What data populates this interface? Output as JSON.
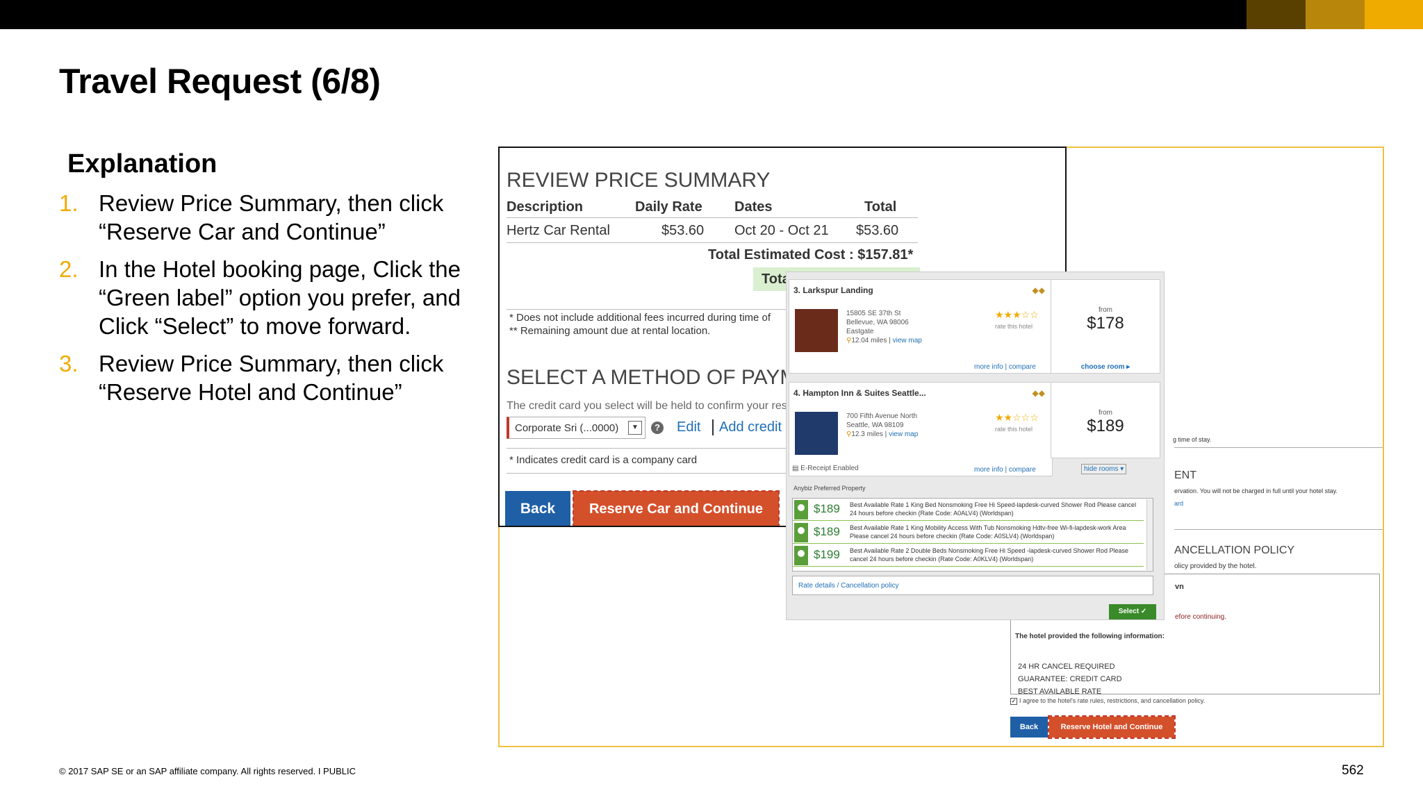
{
  "header": {
    "swatch_colors": [
      "#5a4000",
      "#b8860b",
      "#f0ab00"
    ]
  },
  "slide": {
    "title": "Travel Request (6/8)",
    "explanation_heading": "Explanation",
    "steps": [
      {
        "num": "1.",
        "text": "Review Price Summary, then click “Reserve Car and Continue”"
      },
      {
        "num": "2.",
        "text": "In the Hotel booking page, Click the “Green label” option you prefer, and Click “Select” to move forward."
      },
      {
        "num": "3.",
        "text": "Review Price Summary, then click “Reserve Hotel and Continue”"
      }
    ],
    "footer": "© 2017 SAP SE or an SAP affiliate company. All rights reserved.   I   PUBLIC",
    "page_number": "562"
  },
  "car_summary": {
    "heading": "REVIEW PRICE SUMMARY",
    "columns": [
      "Description",
      "Daily Rate",
      "Dates",
      "Total"
    ],
    "row": [
      "Hertz Car Rental",
      "$53.60",
      "Oct 20 - Oct 21",
      "$53.60"
    ],
    "total_estimated": "Total Estimated Cost : $157.81*",
    "total_green": "Tota",
    "note1": "* Does not include additional fees incurred during time of",
    "note2": "** Remaining amount due at rental location.",
    "payment_heading": "SELECT A METHOD OF PAYME",
    "payment_text": "The credit card you select will be held to confirm your res",
    "card_value": "Corporate Sri (...0000)",
    "edit": "Edit",
    "add_card": "Add credit ca",
    "company_note": "* Indicates credit card is a company card",
    "back": "Back",
    "reserve": "Reserve Car and Continue"
  },
  "hotels": [
    {
      "name": "3. Larkspur Landing",
      "diamonds": "◆◆",
      "address": [
        "15805 SE 37th St",
        "Bellevue, WA 98006",
        "Eastgate"
      ],
      "distance": "12.04 miles",
      "view_map": "view map",
      "stars": "★★★☆☆",
      "rate_text": "rate this hotel",
      "more_info": "more info",
      "compare": "compare",
      "from": "from",
      "price": "$178",
      "cta": "choose room ▸"
    },
    {
      "name": "4. Hampton Inn & Suites Seattle...",
      "diamonds": "◆◆",
      "address": [
        "700 Fifth Avenue North",
        "Seattle, WA 98109"
      ],
      "distance": "12.3 miles",
      "view_map": "view map",
      "stars": "★★☆☆☆",
      "rate_text": "rate this hotel",
      "more_info": "more info",
      "compare": "compare",
      "from": "from",
      "price": "$189",
      "cta": "hide rooms ▾"
    }
  ],
  "hotel_panel": {
    "ereceipt": "E-Receipt Enabled",
    "preferred": "Anybiz Preferred Property",
    "rooms": [
      {
        "price": "$189",
        "desc": "Best Available Rate 1 King Bed Nonsmoking Free Hi Speed-lapdesk-curved Shower Rod Please cancel 24 hours before checkin (Rate Code: A0ALV4)  (Worldspan)"
      },
      {
        "price": "$189",
        "desc": "Best Available Rate 1 King Mobility Access With Tub Nonsmoking Hdtv-free Wi-fi-lapdesk-work Area Please cancel 24 hours before checkin (Rate Code: A0SLV4)  (Worldspan)"
      },
      {
        "price": "$199",
        "desc": "Best Available Rate 2 Double Beds Nonsmoking Free Hi Speed -lapdesk-curved Shower Rod Please cancel 24 hours before checkin (Rate Code: A0KLV4)  (Worldspan)"
      }
    ],
    "rate_details": "Rate details / Cancellation policy",
    "select": "Select ✓"
  },
  "hotel_review": {
    "stay_text": "g time of stay.",
    "heading1": "ENT",
    "charge_text": "ervation. You will not be charged in full until your hotel stay.",
    "link_text": "ard",
    "heading2": "ANCELLATION POLICY",
    "policy_text": "olicy provided by the hotel.",
    "brand": "vn",
    "before_continuing": "efore continuing.",
    "provided": "The hotel provided the following information:",
    "info_lines": "24 HR CANCEL REQUIRED\nGUARANTEE: CREDIT CARD\nBEST AVAILABLE RATE",
    "agree": "I agree to the hotel's rate rules, restrictions, and cancellation policy.",
    "back": "Back",
    "reserve": "Reserve Hotel and Continue"
  }
}
